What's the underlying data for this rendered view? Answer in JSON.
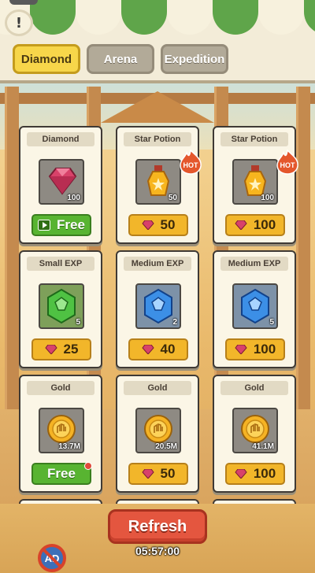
{
  "tabs": [
    {
      "label": "Diamond",
      "active": true
    },
    {
      "label": "Arena",
      "active": false
    },
    {
      "label": "Expedition",
      "active": false
    }
  ],
  "shop": {
    "items": [
      {
        "name": "Diamond",
        "icon": "ruby-gem-icon",
        "qty": "100",
        "price_label": "Free",
        "price_type": "ad-free",
        "hot": false,
        "notify": false
      },
      {
        "name": "Star Potion",
        "icon": "star-potion-icon",
        "qty": "50",
        "price_label": "50",
        "price_type": "gem",
        "hot": true,
        "notify": false
      },
      {
        "name": "Star Potion",
        "icon": "star-potion-icon",
        "qty": "100",
        "price_label": "100",
        "price_type": "gem",
        "hot": true,
        "notify": false
      },
      {
        "name": "Small EXP",
        "icon": "green-exp-crystal-icon",
        "qty": "5",
        "price_label": "25",
        "price_type": "gem",
        "hot": false,
        "notify": false
      },
      {
        "name": "Medium EXP",
        "icon": "blue-exp-crystal-icon",
        "qty": "2",
        "price_label": "40",
        "price_type": "gem",
        "hot": false,
        "notify": false
      },
      {
        "name": "Medium EXP",
        "icon": "blue-exp-crystal-icon",
        "qty": "5",
        "price_label": "100",
        "price_type": "gem",
        "hot": false,
        "notify": false
      },
      {
        "name": "Gold",
        "icon": "gold-coin-icon",
        "qty": "13.7M",
        "price_label": "Free",
        "price_type": "free",
        "hot": false,
        "notify": true
      },
      {
        "name": "Gold",
        "icon": "gold-coin-icon",
        "qty": "20.5M",
        "price_label": "50",
        "price_type": "gem",
        "hot": false,
        "notify": false
      },
      {
        "name": "Gold",
        "icon": "gold-coin-icon",
        "qty": "41.1M",
        "price_label": "100",
        "price_type": "gem",
        "hot": false,
        "notify": false
      }
    ],
    "hot_label": "HOT"
  },
  "refresh": {
    "label": "Refresh",
    "timer": "05:57:00"
  },
  "no_ads_label": "AD",
  "info_label": "!",
  "colors": {
    "accent": "#f7d64a",
    "price": "#f2b62a",
    "free": "#58b431",
    "refresh": "#e4563f",
    "awning_green": "#5fa54a"
  }
}
